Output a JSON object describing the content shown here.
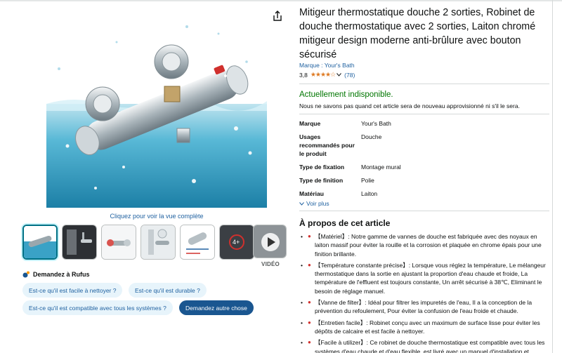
{
  "gallery": {
    "zoom_link": "Cliquez pour voir la vue complète",
    "thumbnail_count": 7,
    "video_label": "VIDÉO",
    "video_badge": "4+"
  },
  "rufus": {
    "title": "Demandez à Rufus",
    "chips": [
      "Est-ce qu'il est facile à nettoyer ?",
      "Est-ce qu'il est durable ?",
      "Est-ce qu'il est compatible avec tous les systèmes ?",
      "Demandez autre chose"
    ]
  },
  "product": {
    "title": "Mitigeur thermostatique douche 2 sorties, Robinet de douche thermostatique avec 2 sorties, Laiton chromé mitigeur design moderne anti-brûlure avec bouton sécurisé",
    "brand": "Marque : Your's Bath",
    "rating": "3,8",
    "stars": 3.8,
    "reviews": "(78)",
    "availability": "Actuellement indisponible.",
    "availability_note": "Nous ne savons pas quand cet article sera de nouveau approvisionné ni s'il le sera."
  },
  "specs": [
    {
      "key": "Marque",
      "value": "Your's Bath"
    },
    {
      "key": "Usages recommandés pour le produit",
      "value": "Douche"
    },
    {
      "key": "Type de fixation",
      "value": "Montage mural"
    },
    {
      "key": "Type de finition",
      "value": "Polie"
    },
    {
      "key": "Matériau",
      "value": "Laiton"
    }
  ],
  "see_more": "Voir plus",
  "about": {
    "title": "À propos de cet article",
    "bullets": [
      "【Matériel】: Notre gamme de vannes de douche est fabriquée avec des noyaux en laiton massif pour éviter la rouille et la corrosion et plaquée en chrome épais pour une finition brillante.",
      "【Température constante précise】: Lorsque vous réglez la température, Le mélangeur thermostatique dans la sortie en ajustant la proportion d'eau chaude et froide, La température de l'effluent est toujours constante, Un arrêt sécurisé à 38℃, Eliminant le besoin de réglage manuel.",
      "【Vanne de filter】: Idéal pour filtrer les impuretés de l'eau, Il a la conception de la prévention du refoulement, Pour éviter la confusion de l'eau froide et chaude.",
      "【Entretien facile】: Robinet conçu avec un maximum de surface lisse pour éviter les dépôts de calcaire et est facile à nettoyer.",
      "【Facile à utilizer】: Ce robinet de douche thermostatique est compatible avec tous les systèmes d'eau chaude et d'eau flexible, est livré avec un manuel d'installation et"
    ]
  },
  "colors": {
    "link": "#2162a1",
    "green": "#007600",
    "star": "#de7921",
    "chip_bg": "#e7f4fb",
    "chip_dark": "#1a5690"
  }
}
